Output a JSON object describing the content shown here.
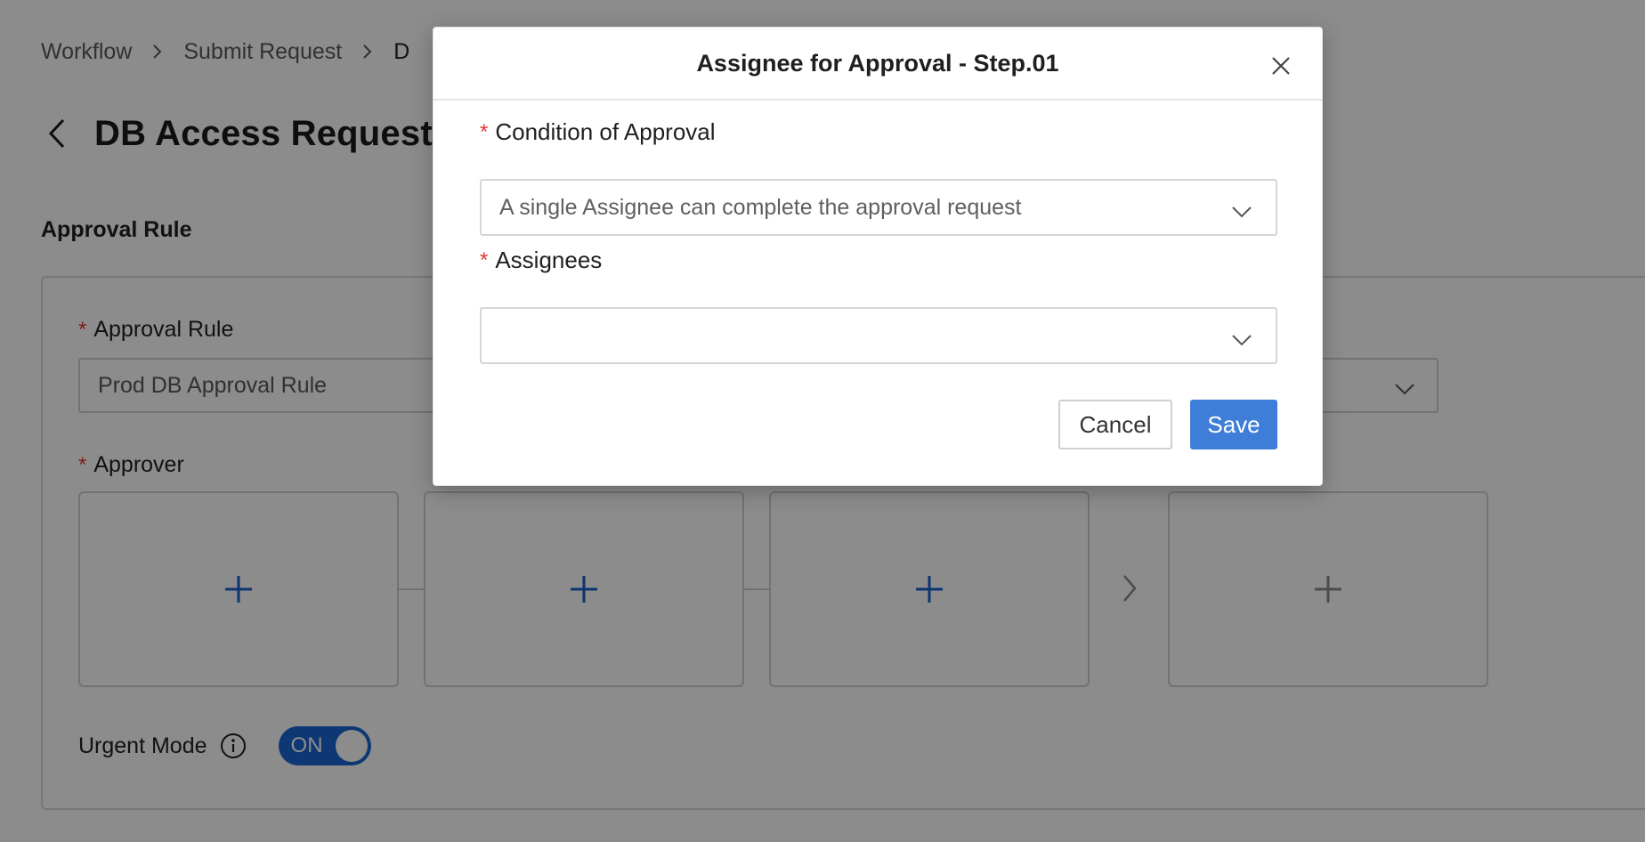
{
  "breadcrumb": {
    "items": [
      "Workflow",
      "Submit Request",
      "D"
    ]
  },
  "page": {
    "title": "DB Access Request"
  },
  "approval_section": {
    "title": "Approval Rule",
    "rule_label": "Approval Rule",
    "rule_value": "Prod DB Approval Rule",
    "approver_label": "Approver",
    "urgent_label": "Urgent Mode",
    "urgent_toggle": "ON"
  },
  "modal": {
    "title": "Assignee for Approval - Step.01",
    "condition_label": "Condition of Approval",
    "condition_value": "A single Assignee can complete the approval request",
    "assignees_label": "Assignees",
    "assignees_value": "",
    "cancel_label": "Cancel",
    "save_label": "Save"
  },
  "colors": {
    "accent": "#3e7ed8",
    "toggle": "#1b67d4",
    "required": "#e03a2f",
    "plus_active": "#1b5fd0",
    "plus_disabled": "#8a8a8a"
  },
  "icons": {
    "close": "close-icon",
    "chevron": "chevron-down-icon",
    "back": "chevron-left-icon",
    "info": "info-icon",
    "add": "plus-icon"
  }
}
